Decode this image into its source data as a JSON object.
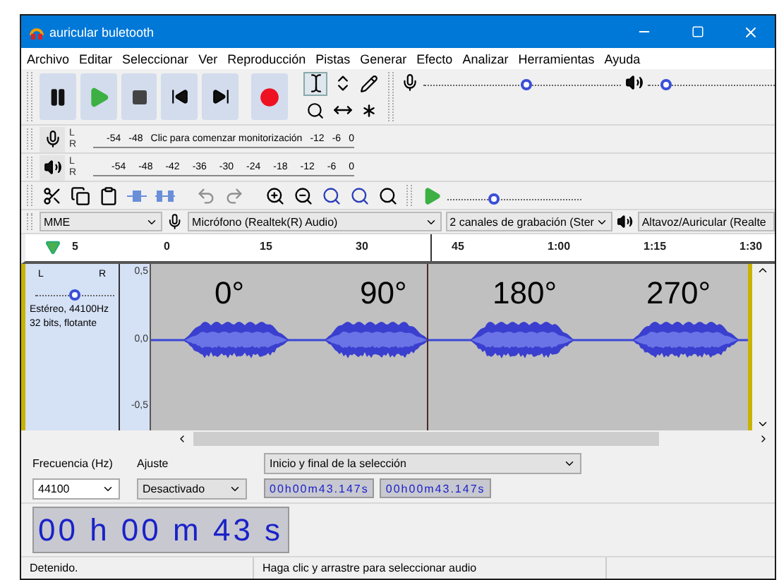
{
  "window": {
    "title": "auricular buletooth"
  },
  "menu": [
    "Archivo",
    "Editar",
    "Seleccionar",
    "Ver",
    "Reproducción",
    "Pistas",
    "Generar",
    "Efecto",
    "Analizar",
    "Herramientas",
    "Ayuda"
  ],
  "transport": [
    {
      "kind": "pause"
    },
    {
      "kind": "play"
    },
    {
      "kind": "stop"
    },
    {
      "kind": "skip-start"
    },
    {
      "kind": "skip-end"
    },
    {
      "kind": "record"
    }
  ],
  "tools": [
    {
      "kind": "select",
      "selected": true
    },
    {
      "kind": "envelope",
      "selected": false
    },
    {
      "kind": "draw",
      "selected": false
    },
    {
      "kind": "zoom",
      "selected": false
    },
    {
      "kind": "timeshift",
      "selected": false
    },
    {
      "kind": "multi",
      "selected": false
    }
  ],
  "mixer": {
    "record": {
      "level": 0.52
    },
    "playback": {
      "level": 0.15
    }
  },
  "meters": [
    {
      "kind": "record",
      "channels": [
        "L",
        "R"
      ],
      "ticks": [
        "-54",
        "-48"
      ],
      "hint": "Clic para comenzar monitorización",
      "ticks_after": [
        "-12",
        "-6",
        "0"
      ]
    },
    {
      "kind": "playback",
      "channels": [
        "L",
        "R"
      ],
      "ticks": [
        "-54",
        "-48",
        "-42",
        "-36",
        "-30",
        "-24",
        "-18",
        "-12",
        "-6",
        "0"
      ]
    }
  ],
  "play_speed": {
    "level": 0.35
  },
  "devices": {
    "host": "MME",
    "input": "Micrófono (Realtek(R) Audio)",
    "channels": "2 canales de grabación (Ster",
    "output": "Altavoz/Auricular (Realte"
  },
  "ruler": [
    "5",
    "0",
    "15",
    "30",
    "45",
    "1:00",
    "1:15",
    "1:30"
  ],
  "track": {
    "pan_left": "L",
    "pan_right": "R",
    "pan": {
      "level": 0.5
    },
    "info": [
      "Estéreo, 44100Hz",
      "32 bits, flotante"
    ],
    "scale": [
      "0,5",
      "0,0",
      "-0,5"
    ],
    "labels": [
      "0°",
      "90°",
      "180°",
      "270°"
    ]
  },
  "selection": {
    "rate_label": "Frecuencia (Hz)",
    "snap_label": "Ajuste",
    "mode": "Inicio y final de la selección",
    "rate": "44100",
    "snap": "Desactivado",
    "start": "00h00m43.147s",
    "end": "00h00m43.147s"
  },
  "time": "00 h 00 m 43 s",
  "status": {
    "state": "Detenido.",
    "hint": "Haga clic y arrastre para seleccionar audio"
  }
}
